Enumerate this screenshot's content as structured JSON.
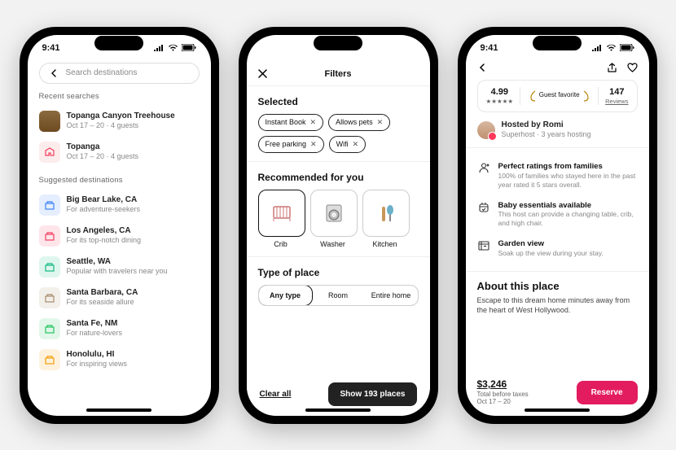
{
  "status": {
    "time": "9:41"
  },
  "search": {
    "placeholder": "Search destinations",
    "recent_label": "Recent searches",
    "recents": [
      {
        "title": "Topanga Canyon Treehouse",
        "sub": "Oct 17 – 20 · 4 guests"
      },
      {
        "title": "Topanga",
        "sub": "Oct 17 – 20 · 4 guests"
      }
    ],
    "suggested_label": "Suggested destinations",
    "suggestions": [
      {
        "title": "Big Bear Lake, CA",
        "sub": "For adventure-seekers",
        "color": "#3b82f6"
      },
      {
        "title": "Los Angeles, CA",
        "sub": "For its top-notch dining",
        "color": "#f43f5e"
      },
      {
        "title": "Seattle, WA",
        "sub": "Popular with travelers near you",
        "color": "#10b981"
      },
      {
        "title": "Santa Barbara, CA",
        "sub": "For its seaside allure",
        "color": "#a78b6b"
      },
      {
        "title": "Santa Fe, NM",
        "sub": "For nature-lovers",
        "color": "#22c55e"
      },
      {
        "title": "Honolulu, HI",
        "sub": "For inspiring views",
        "color": "#f59e0b"
      }
    ]
  },
  "filters": {
    "title": "Filters",
    "selected_label": "Selected",
    "selected": [
      "Instant Book",
      "Allows pets",
      "Free parking",
      "Wifi"
    ],
    "recommended_label": "Recommended for you",
    "recommended": [
      {
        "label": "Crib",
        "selected": true
      },
      {
        "label": "Washer",
        "selected": false
      },
      {
        "label": "Kitchen",
        "selected": false
      }
    ],
    "type_label": "Type of place",
    "types": [
      "Any type",
      "Room",
      "Entire home"
    ],
    "type_selected": 0,
    "clear": "Clear all",
    "show": "Show 193 places"
  },
  "listing": {
    "rating": "4.99",
    "favorite": "Guest favorite",
    "reviews_num": "147",
    "reviews_label": "Reviews",
    "host_line": "Hosted by Romi",
    "host_sub": "Superhost · 3 years hosting",
    "bullets": [
      {
        "title": "Perfect ratings from families",
        "sub": "100% of families who stayed here in the past year rated it 5 stars overall."
      },
      {
        "title": "Baby essentials available",
        "sub": "This host can provide a changing table, crib, and high chair."
      },
      {
        "title": "Garden view",
        "sub": "Soak up the view during your stay."
      }
    ],
    "about_h": "About this place",
    "about_p": "Escape to this dream home minutes away from the heart of West Hollywood.",
    "price": "$3,246",
    "price_sub": "Total before taxes",
    "dates": "Oct 17 – 20",
    "reserve": "Reserve"
  }
}
